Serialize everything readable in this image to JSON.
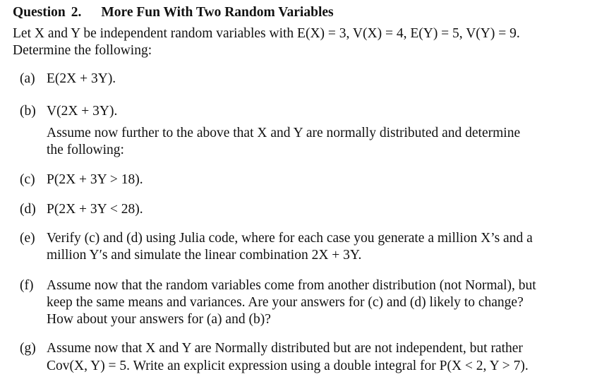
{
  "question": {
    "label": "Question",
    "number": "2.",
    "title": "More Fun With Two Random Variables"
  },
  "intro": {
    "line1": "Let X and Y be independent random variables with E(X) = 3, V(X) = 4, E(Y) = 5,  V(Y) = 9.",
    "line2": "Determine the following:"
  },
  "items": [
    {
      "label": "(a)",
      "lines": [
        "E(2X + 3Y)."
      ]
    },
    {
      "label": "(b)",
      "lines": [
        "V(2X + 3Y)."
      ]
    },
    {
      "label": "",
      "lines": [
        "Assume now further to the above that X and Y are normally distributed and determine",
        "the following:"
      ]
    },
    {
      "label": "(c)",
      "lines": [
        "P(2X + 3Y > 18)."
      ]
    },
    {
      "label": "(d)",
      "lines": [
        "P(2X + 3Y < 28)."
      ]
    },
    {
      "label": "(e)",
      "lines": [
        "Verify (c) and (d) using Julia code, where for each case you generate a million X’s and a",
        "million Y′s and simulate the linear combination 2X + 3Y."
      ]
    },
    {
      "label": "(f)",
      "lines": [
        "Assume now that the random variables come from another distribution (not Normal), but",
        "keep the same means and variances.  Are your answers for (c) and (d) likely to change?",
        "How about your answers for (a) and (b)?"
      ]
    },
    {
      "label": "(g)",
      "lines": [
        "Assume now that X and Y are Normally distributed but are not independent, but rather",
        "Cov(X, Y) = 5.  Write an explicit expression using a double integral for P(X < 2, Y > 7)."
      ]
    }
  ]
}
